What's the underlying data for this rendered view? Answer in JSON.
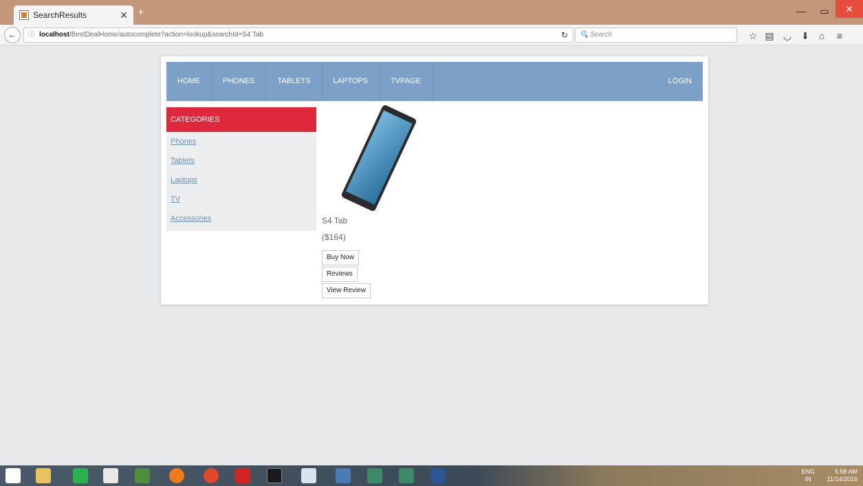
{
  "browser": {
    "tab_title": "SearchResults",
    "new_tab": "+",
    "url_host": "localhost",
    "url_path": "/BestDealHome/autocomplete?action=lookup&searchId=S4 Tab",
    "search_placeholder": "Search"
  },
  "nav": {
    "items": [
      "HOME",
      "PHONES",
      "TABLETS",
      "LAPTOPS",
      "TVPAGE"
    ],
    "login": "LOGIN"
  },
  "sidebar": {
    "header": "CATEGORIES",
    "links": [
      "Phones",
      "Tablets",
      "Laptops",
      "TV",
      "Accessories"
    ]
  },
  "product": {
    "name": "S4 Tab",
    "price": "($164)",
    "buttons": [
      "Buy Now",
      "Reviews",
      "View Review"
    ]
  },
  "taskbar": {
    "lang_top": "ENG",
    "lang_bottom": "IN",
    "time": "5:58 AM",
    "date": "11/14/2016"
  }
}
